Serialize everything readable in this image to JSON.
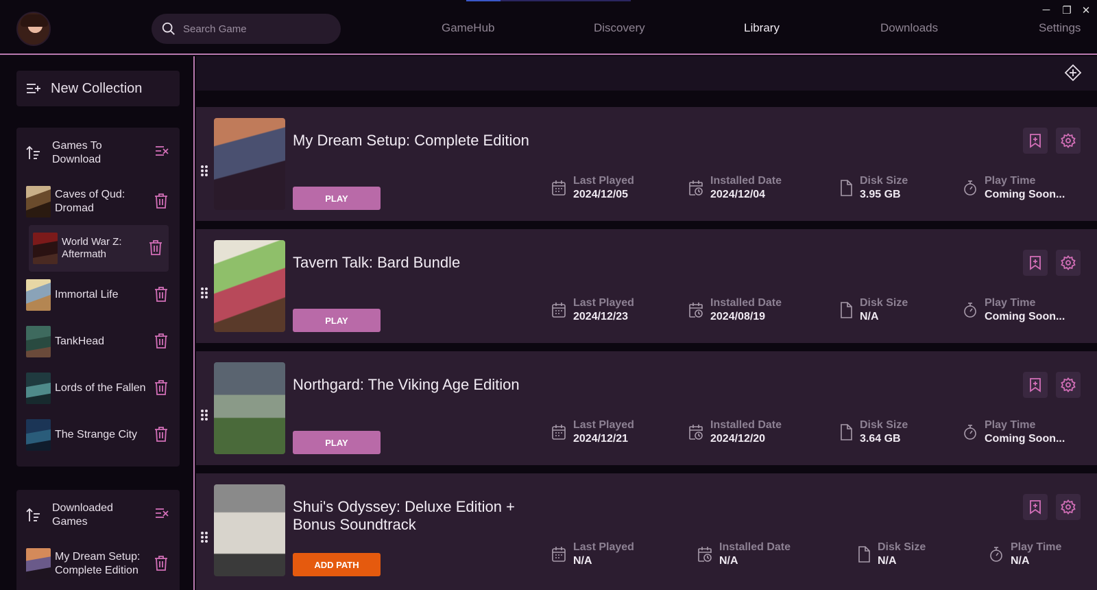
{
  "header": {
    "search": {
      "placeholder": "Search Game"
    },
    "nav": [
      {
        "label": "GameHub"
      },
      {
        "label": "Discovery"
      },
      {
        "label": "Library"
      },
      {
        "label": "Downloads"
      },
      {
        "label": "Settings"
      }
    ],
    "window_controls": {
      "minimize": "─",
      "restore": "❐",
      "close": "✕"
    }
  },
  "sidebar": {
    "new_collection_label": "New Collection",
    "collections": [
      {
        "title": "Games To Download",
        "games": [
          {
            "name": "Caves of Qud: Dromad"
          },
          {
            "name": "World War Z: Aftermath"
          },
          {
            "name": "Immortal Life"
          },
          {
            "name": "TankHead"
          },
          {
            "name": "Lords of the Fallen"
          },
          {
            "name": "The Strange City"
          }
        ]
      },
      {
        "title": "Downloaded Games",
        "games": [
          {
            "name": "My Dream Setup: Complete Edition"
          }
        ]
      }
    ]
  },
  "library": {
    "stat_labels": {
      "last_played": "Last Played",
      "installed_date": "Installed Date",
      "disk_size": "Disk Size",
      "play_time": "Play Time"
    },
    "games": [
      {
        "title": "My Dream Setup: Complete Edition",
        "button": "PLAY",
        "last_played": "2024/12/05",
        "installed_date": "2024/12/04",
        "disk_size": "3.95 GB",
        "play_time": "Coming Soon..."
      },
      {
        "title": "Tavern Talk: Bard Bundle",
        "button": "PLAY",
        "last_played": "2024/12/23",
        "installed_date": "2024/08/19",
        "disk_size": "N/A",
        "play_time": "Coming Soon..."
      },
      {
        "title": "Northgard: The Viking Age Edition",
        "button": "PLAY",
        "last_played": "2024/12/21",
        "installed_date": "2024/12/20",
        "disk_size": "3.64 GB",
        "play_time": "Coming Soon..."
      },
      {
        "title": "Shui's Odyssey: Deluxe Edition + Bonus Soundtrack",
        "button": "ADD PATH",
        "last_played": "N/A",
        "installed_date": "N/A",
        "disk_size": "N/A",
        "play_time": "N/A"
      }
    ]
  },
  "colors": {
    "accent": "#b96aa8",
    "add_path": "#e55a0e",
    "card_bg": "#2c1d30",
    "icon_pink": "#d36fb8"
  }
}
